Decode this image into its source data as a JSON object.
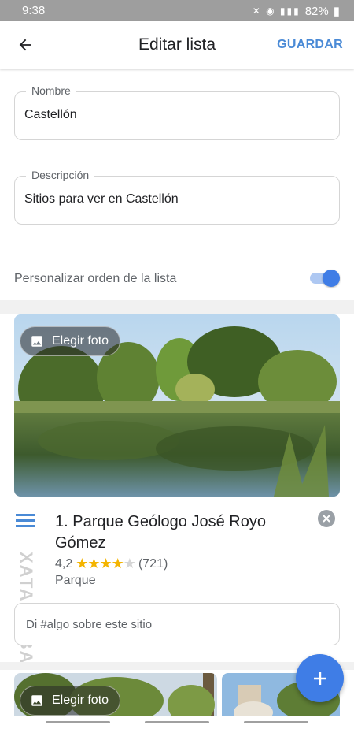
{
  "status_bar": {
    "time": "9:38",
    "battery": "82%"
  },
  "header": {
    "title": "Editar lista",
    "save_label": "GUARDAR"
  },
  "form": {
    "name_label": "Nombre",
    "name_value": "Castellón",
    "description_label": "Descripción",
    "description_value": "Sitios para ver en Castellón"
  },
  "reorder": {
    "label": "Personalizar orden de la lista",
    "enabled": true
  },
  "places": [
    {
      "choose_photo_label": "Elegir foto",
      "title": "1. Parque Geólogo José Royo Gómez",
      "rating": "4,2",
      "stars": "★★★★",
      "star_empty": "★",
      "reviews": "(721)",
      "type": "Parque",
      "note_placeholder": "Di #algo sobre este sitio"
    },
    {
      "choose_photo_label": "Elegir foto"
    }
  ],
  "watermark": "XATAKA BASICS",
  "colors": {
    "accent": "#3f7de6",
    "save": "#4a8ad6",
    "star": "#f4b400"
  }
}
